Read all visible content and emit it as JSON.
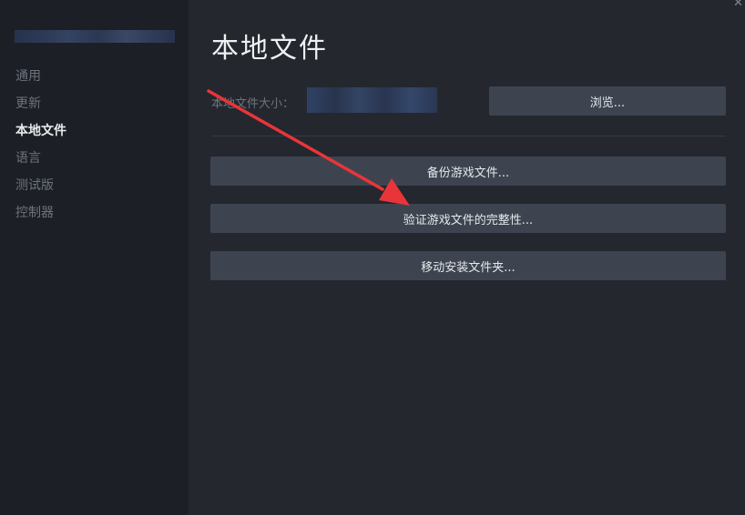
{
  "window": {
    "close_glyph": "✕"
  },
  "sidebar": {
    "items": [
      {
        "label": "通用",
        "active": false
      },
      {
        "label": "更新",
        "active": false
      },
      {
        "label": "本地文件",
        "active": true
      },
      {
        "label": "语言",
        "active": false
      },
      {
        "label": "测试版",
        "active": false
      },
      {
        "label": "控制器",
        "active": false
      }
    ]
  },
  "main": {
    "title": "本地文件",
    "size_label": "本地文件大小：",
    "browse_label": "浏览...",
    "backup_label": "备份游戏文件...",
    "verify_label": "验证游戏文件的完整性...",
    "move_label": "移动安装文件夹..."
  },
  "colors": {
    "background": "#24272e",
    "sidebar": "#1c1f25",
    "button": "#3d4450",
    "arrow": "#e8353a"
  },
  "icons": {
    "close": "close-icon",
    "annotation": "red-arrow-icon"
  }
}
